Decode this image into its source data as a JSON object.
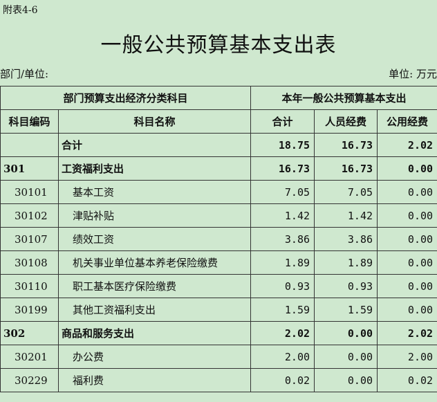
{
  "appendix": "附表4-6",
  "title": "一般公共预算基本支出表",
  "dept_label": "部门/单位:",
  "unit_label": "单位: 万元",
  "header": {
    "group_left": "部门预算支出经济分类科目",
    "group_right": "本年一般公共预算基本支出",
    "col_code": "科目编码",
    "col_name": "科目名称",
    "col_total": "合计",
    "col_personnel": "人员经费",
    "col_public": "公用经费"
  },
  "rows": [
    {
      "code": "",
      "name": "合计",
      "total": "18.75",
      "personnel": "16.73",
      "public": "2.02"
    },
    {
      "code": "301",
      "name": "工资福利支出",
      "total": "16.73",
      "personnel": "16.73",
      "public": "0.00"
    },
    {
      "code": "30101",
      "name": "基本工资",
      "total": "7.05",
      "personnel": "7.05",
      "public": "0.00"
    },
    {
      "code": "30102",
      "name": "津贴补贴",
      "total": "1.42",
      "personnel": "1.42",
      "public": "0.00"
    },
    {
      "code": "30107",
      "name": "绩效工资",
      "total": "3.86",
      "personnel": "3.86",
      "public": "0.00"
    },
    {
      "code": "30108",
      "name": "机关事业单位基本养老保险缴费",
      "total": "1.89",
      "personnel": "1.89",
      "public": "0.00"
    },
    {
      "code": "30110",
      "name": "职工基本医疗保险缴费",
      "total": "0.93",
      "personnel": "0.93",
      "public": "0.00"
    },
    {
      "code": "30199",
      "name": "其他工资福利支出",
      "total": "1.59",
      "personnel": "1.59",
      "public": "0.00"
    },
    {
      "code": "302",
      "name": "商品和服务支出",
      "total": "2.02",
      "personnel": "0.00",
      "public": "2.02"
    },
    {
      "code": "30201",
      "name": "办公费",
      "total": "2.00",
      "personnel": "0.00",
      "public": "2.00"
    },
    {
      "code": "30229",
      "name": "福利费",
      "total": "0.02",
      "personnel": "0.00",
      "public": "0.02"
    }
  ]
}
